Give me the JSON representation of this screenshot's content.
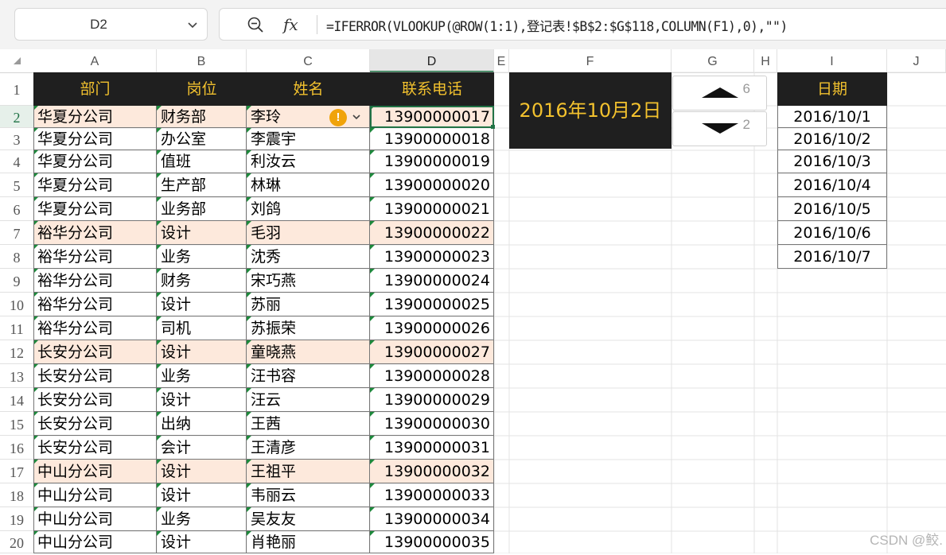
{
  "name_box": "D2",
  "formula": "=IFERROR(VLOOKUP(@ROW(1:1),登记表!$B$2:$G$118,COLUMN(F1),0),\"\")",
  "columns": [
    "A",
    "B",
    "C",
    "D",
    "E",
    "F",
    "G",
    "H",
    "I",
    "J"
  ],
  "rows": [
    "1",
    "2",
    "3",
    "4",
    "5",
    "6",
    "7",
    "8",
    "9",
    "10",
    "11",
    "12",
    "13",
    "14",
    "15",
    "16",
    "17",
    "18",
    "19",
    "20"
  ],
  "table": {
    "headers": [
      "部门",
      "岗位",
      "姓名",
      "联系电话"
    ],
    "rows": [
      [
        "华夏分公司",
        "财务部",
        "李玲",
        "13900000017"
      ],
      [
        "华夏分公司",
        "办公室",
        "李震宇",
        "13900000018"
      ],
      [
        "华夏分公司",
        "值班",
        "利汝云",
        "13900000019"
      ],
      [
        "华夏分公司",
        "生产部",
        "林琳",
        "13900000020"
      ],
      [
        "华夏分公司",
        "业务部",
        "刘鸽",
        "13900000021"
      ],
      [
        "裕华分公司",
        "设计",
        "毛羽",
        "13900000022"
      ],
      [
        "裕华分公司",
        "业务",
        "沈秀",
        "13900000023"
      ],
      [
        "裕华分公司",
        "财务",
        "宋巧燕",
        "13900000024"
      ],
      [
        "裕华分公司",
        "设计",
        "苏丽",
        "13900000025"
      ],
      [
        "裕华分公司",
        "司机",
        "苏振荣",
        "13900000026"
      ],
      [
        "长安分公司",
        "设计",
        "童晓燕",
        "13900000027"
      ],
      [
        "长安分公司",
        "业务",
        "汪书容",
        "13900000028"
      ],
      [
        "长安分公司",
        "设计",
        "汪云",
        "13900000029"
      ],
      [
        "长安分公司",
        "出纳",
        "王茜",
        "13900000030"
      ],
      [
        "长安分公司",
        "会计",
        "王清彦",
        "13900000031"
      ],
      [
        "中山分公司",
        "设计",
        "王祖平",
        "13900000032"
      ],
      [
        "中山分公司",
        "设计",
        "韦丽云",
        "13900000033"
      ],
      [
        "中山分公司",
        "业务",
        "吴友友",
        "13900000034"
      ],
      [
        "中山分公司",
        "设计",
        "肖艳丽",
        "13900000035"
      ]
    ]
  },
  "date_display": "2016年10月2日",
  "spinners": [
    {
      "value": "6"
    },
    {
      "value": "2"
    }
  ],
  "date_table": {
    "header": "日期",
    "values": [
      "2016/10/1",
      "2016/10/2",
      "2016/10/3",
      "2016/10/4",
      "2016/10/5",
      "2016/10/6",
      "2016/10/7"
    ]
  },
  "watermark": "CSDN @鲛.",
  "colors": {
    "header_bg": "#1f1f1f",
    "header_text": "#f2c12e",
    "highlight_row": "#fde9dc",
    "selection": "#217346"
  }
}
